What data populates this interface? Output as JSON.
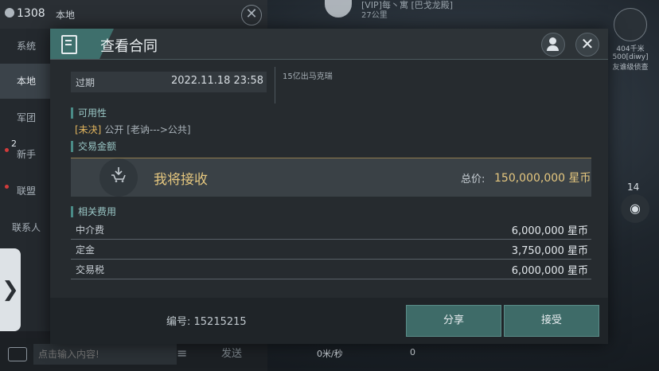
{
  "chat": {
    "online_count": "1308",
    "channel_title": "本地",
    "close_glyph": "✕",
    "channels": [
      {
        "label": "系统",
        "active": false
      },
      {
        "label": "本地",
        "active": true
      },
      {
        "label": "军团",
        "active": false
      },
      {
        "label": "新手",
        "active": false,
        "badge": "2"
      },
      {
        "label": "联盟",
        "active": false
      },
      {
        "label": "联系人",
        "active": false
      }
    ],
    "input_placeholder": "点击输入内容!",
    "send_label": "发送",
    "menu_glyph": "≡",
    "expand_glyph": "❯"
  },
  "hud": {
    "target_name": "[VIP]每丶寓 [巴戈龙殿]",
    "target_sub": "27公里",
    "right_line1": "404千米",
    "right_line2": "500[diwy]",
    "right_line3": "友谁级侦查",
    "count": "14",
    "speed": "0米/秒",
    "speed_value": "0"
  },
  "dialog": {
    "title": "查看合同",
    "close_glyph": "✕",
    "expiry_label": "过期",
    "expiry_value": "2022.11.18 23:58",
    "description": "15亿出马克瑞",
    "availability_heading": "可用性",
    "availability_status": "[未决]",
    "availability_detail": "公开 [老讷--->公共]",
    "amount_heading": "交易金额",
    "receive_label": "我将接收",
    "total_label": "总价:",
    "total_value": "150,000,000 星币",
    "fees_heading": "相关费用",
    "fees": [
      {
        "label": "中介费",
        "value": "6,000,000 星币"
      },
      {
        "label": "定金",
        "value": "3,750,000 星币"
      },
      {
        "label": "交易税",
        "value": "6,000,000 星币"
      }
    ],
    "contract_number": "编号: 15215215",
    "share_label": "分享",
    "accept_label": "接受"
  },
  "colors": {
    "accent_teal": "#3e6b68",
    "gold": "#e5c77f",
    "pending": "#e2b55e"
  },
  "icons": [
    "person-icon",
    "close-icon",
    "contract-document-icon",
    "user-icon",
    "cart-download-icon",
    "keyboard-icon",
    "eye-icon",
    "chevron-right-icon"
  ]
}
